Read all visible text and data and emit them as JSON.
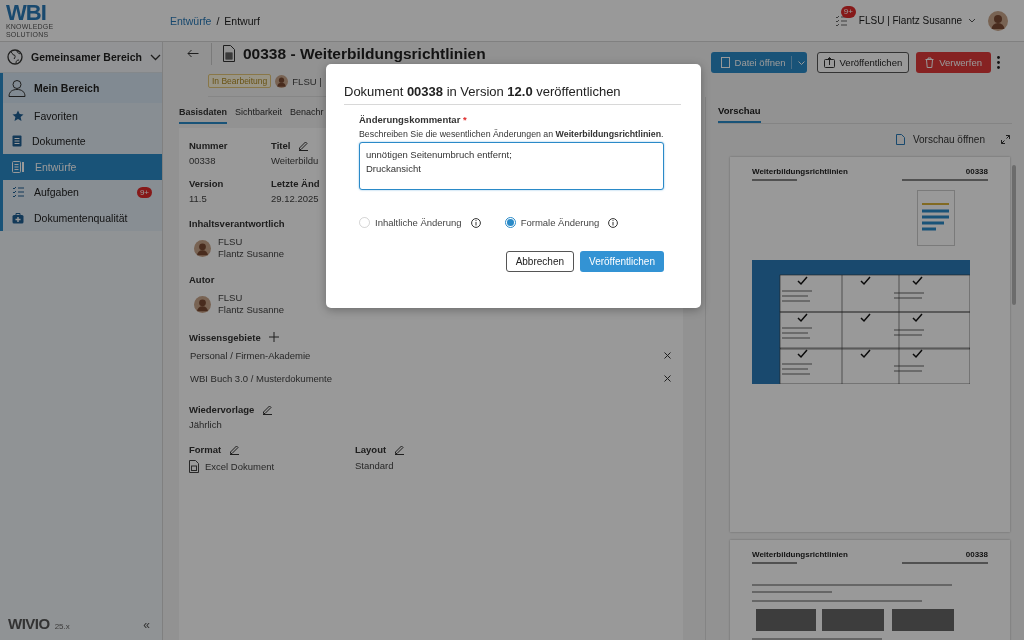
{
  "topbar": {
    "logo": "WBI",
    "logo_subtitle": "KNOWLEDGE SOLUTIONS",
    "breadcrumb": [
      {
        "label": "Entwürfe",
        "kind": "link"
      },
      {
        "label": "Entwurf",
        "kind": "current"
      }
    ],
    "separator": "/",
    "task_badge": "9+",
    "user": "FLSU | Flantz Susanne"
  },
  "sidebar": {
    "workspace": "Gemeinsamer Bereich",
    "section": "Mein Bereich",
    "items": [
      {
        "label": "Favoriten",
        "selected": false
      },
      {
        "label": "Dokumente",
        "selected": false
      },
      {
        "label": "Entwürfe",
        "selected": true
      },
      {
        "label": "Aufgaben",
        "selected": false,
        "badge": "9+"
      },
      {
        "label": "Dokumentenqualität",
        "selected": false
      }
    ],
    "footer_logo": "WIVIO",
    "footer_version": "25.x",
    "collapse": "«"
  },
  "document": {
    "title": "00338 - Weiterbildungsrichtlinien",
    "status": "In Bearbeitung",
    "owner": "FLSU |",
    "actions": [
      {
        "label": "Datei öffnen",
        "kind": "split"
      },
      {
        "label": "Veröffentlichen",
        "kind": "outline"
      },
      {
        "label": "Verwerfen",
        "kind": "danger"
      }
    ],
    "tabs": [
      {
        "label": "Basisdaten",
        "selected": true
      },
      {
        "label": "Sichtbarkeit",
        "selected": false
      },
      {
        "label": "Benachr",
        "selected": false
      }
    ],
    "fields": [
      {
        "label": "Nummer",
        "value": "00338",
        "editable": false
      },
      {
        "label": "Titel",
        "value": "Weiterbildu",
        "editable": true
      },
      {
        "label": "Version",
        "value": "11.5",
        "editable": false
      },
      {
        "label": "Letzte Änd",
        "value": "29.12.2025",
        "editable": false
      }
    ],
    "persons": [
      {
        "label": "Inhaltsverantwortlich",
        "code": "FLSU",
        "name": "Flantz Susanne"
      },
      {
        "label": "Autor",
        "code": "FLSU",
        "name": "Flantz Susanne"
      }
    ],
    "knowledge_areas": {
      "label": "Wissensgebiete",
      "items": [
        "Personal / Firmen-Akademie",
        "WBI Buch 3.0 / Musterdokumente"
      ]
    },
    "resubmission": {
      "label": "Wiedervorlage",
      "value": "Jährlich"
    },
    "format": {
      "label": "Format",
      "value": "Excel Dokument"
    },
    "layout": {
      "label": "Layout",
      "value": "Standard"
    }
  },
  "preview": {
    "tab": "Vorschau",
    "open_button": "Vorschau öffnen",
    "pages": [
      {
        "title": "Weiterbildungsrichtlinien",
        "number": "00338",
        "kind": "table"
      },
      {
        "title": "Weiterbildungsrichtlinien",
        "number": "00338",
        "kind": "text"
      }
    ]
  },
  "dialog": {
    "title": "Dokument **00338** in Version **12.0** veröffentlichen",
    "comment_label": "Änderungskommentar",
    "required_mark": "*",
    "hint": "Beschreiben Sie die wesentlichen Änderungen an **Weiterbildungsrichtlinien**.",
    "comment_value": "unnötigen Seitenumbruch entfernt;\nDruckansicht ",
    "change_types": [
      {
        "label": "Inhaltliche Änderung",
        "selected": false,
        "disabled": true
      },
      {
        "label": "Formale Änderung",
        "selected": true,
        "disabled": false
      }
    ],
    "buttons": [
      {
        "label": "Abbrechen",
        "kind": "secondary"
      },
      {
        "label": "Veröffentlichen",
        "kind": "primary"
      }
    ]
  }
}
